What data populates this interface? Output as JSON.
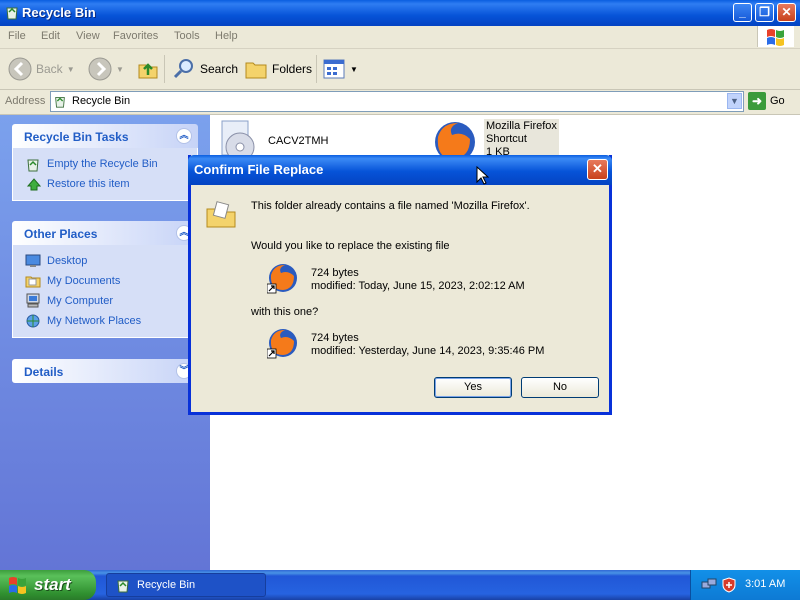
{
  "window": {
    "title": "Recycle Bin",
    "buttons": {
      "minimize": "_",
      "maximize": "❐",
      "close": "✕"
    }
  },
  "menu": [
    "File",
    "Edit",
    "View",
    "Favorites",
    "Tools",
    "Help"
  ],
  "toolbar": {
    "back": "Back",
    "search": "Search",
    "folders": "Folders"
  },
  "address": {
    "label": "Address",
    "value": "Recycle Bin",
    "go": "Go"
  },
  "sidebar": {
    "tasks": {
      "title": "Recycle Bin Tasks",
      "items": [
        {
          "label": "Empty the Recycle Bin",
          "icon": "recycle-bin-icon"
        },
        {
          "label": "Restore this item",
          "icon": "restore-arrow-icon"
        }
      ]
    },
    "places": {
      "title": "Other Places",
      "items": [
        {
          "label": "Desktop",
          "icon": "desktop-icon"
        },
        {
          "label": "My Documents",
          "icon": "documents-folder-icon"
        },
        {
          "label": "My Computer",
          "icon": "computer-icon"
        },
        {
          "label": "My Network Places",
          "icon": "network-icon"
        }
      ]
    },
    "details": {
      "title": "Details"
    }
  },
  "files": [
    {
      "name": "CACV2TMH",
      "icon": "installer-disc-icon"
    },
    {
      "name": "Mozilla Firefox",
      "line2": "Shortcut",
      "line3": "1 KB",
      "icon": "firefox-icon"
    }
  ],
  "dialog": {
    "title": "Confirm File Replace",
    "message": "This folder already contains a file named 'Mozilla Firefox'.",
    "question": "Would you like to replace the existing file",
    "existing": {
      "size": "724 bytes",
      "modified": "modified: Today, June 15, 2023, 2:02:12 AM"
    },
    "with_label": "with this one?",
    "incoming": {
      "size": "724 bytes",
      "modified": "modified: Yesterday, June 14, 2023, 9:35:46 PM"
    },
    "yes": "Yes",
    "no": "No",
    "close": "✕"
  },
  "taskbar": {
    "start": "start",
    "task": "Recycle Bin",
    "clock": "3:01 AM"
  },
  "colors": {
    "title_blue": "#0653d8",
    "panel_text": "#215dc6",
    "taskbar_blue": "#2663e0",
    "start_green": "#3c9e3c"
  }
}
